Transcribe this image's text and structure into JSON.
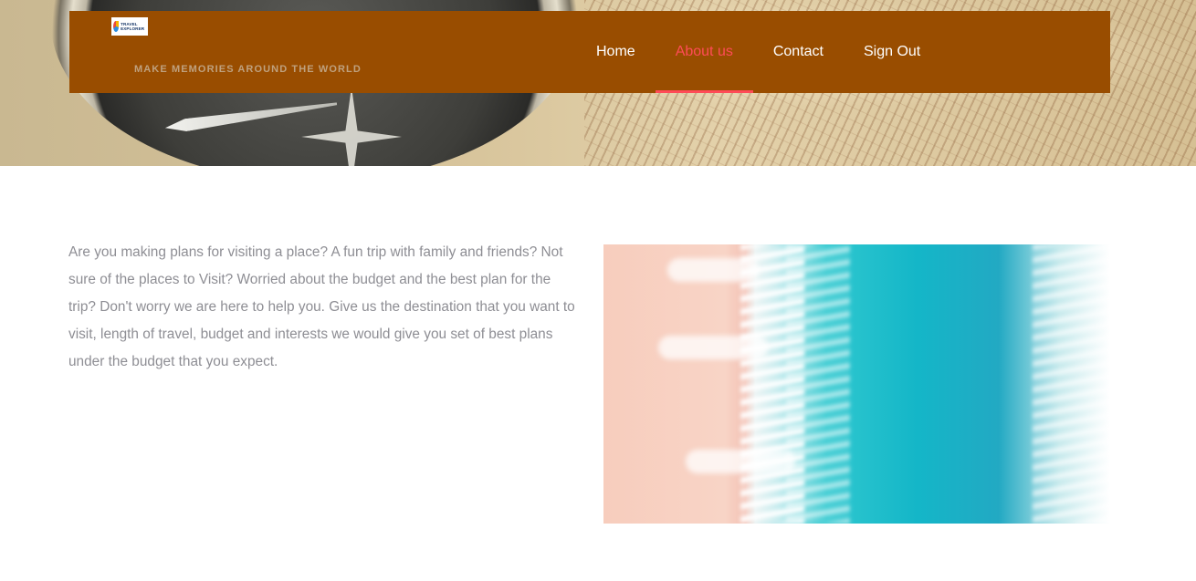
{
  "header": {
    "logo_text": "TRAVEL EXPLORER",
    "tagline": "MAKE MEMORIES AROUND THE WORLD"
  },
  "nav": {
    "items": [
      {
        "label": "Home",
        "active": false
      },
      {
        "label": "About us",
        "active": true
      },
      {
        "label": "Contact",
        "active": false
      },
      {
        "label": "Sign Out",
        "active": false
      }
    ]
  },
  "about": {
    "text": "Are you making plans for visiting a place? A fun trip with family and friends? Not sure of the places to Visit? Worried about the budget and the best plan for the trip? Don't worry we are here to help you. Give us the destination that you want to visit, length of travel, budget and interests we would give you set of best plans under the budget that you expect."
  },
  "colors": {
    "navbar_bg": "#994d00",
    "nav_active": "#ff4b57",
    "nav_text": "#ffffff",
    "body_text": "#8e8e94"
  }
}
